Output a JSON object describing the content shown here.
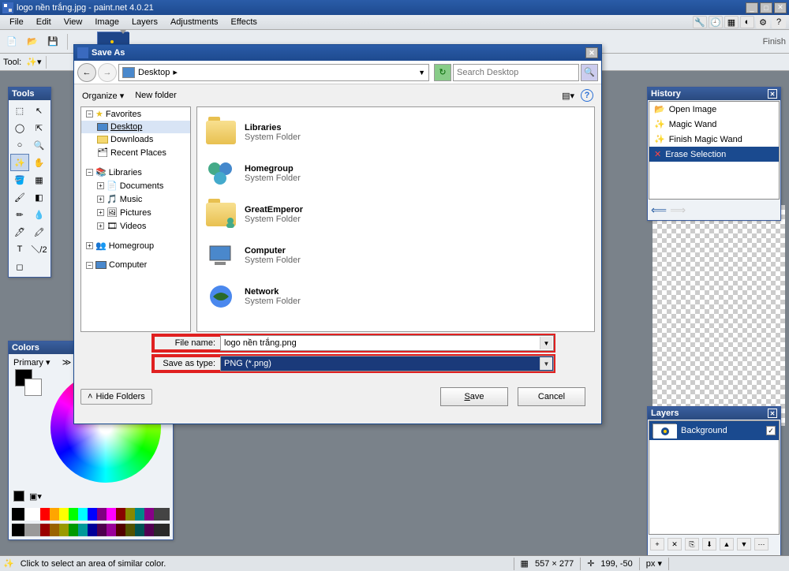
{
  "app": {
    "title": "logo nền trắng.jpg - paint.net 4.0.21",
    "menu": {
      "file": "File",
      "edit": "Edit",
      "view": "View",
      "image": "Image",
      "layers": "Layers",
      "adjustments": "Adjustments",
      "effects": "Effects"
    }
  },
  "toolrow": {
    "label": "Tool:"
  },
  "tools_panel": {
    "title": "Tools"
  },
  "colors_panel": {
    "title": "Colors",
    "primary": "Primary"
  },
  "history_panel": {
    "title": "History",
    "items": [
      "Open Image",
      "Magic Wand",
      "Finish Magic Wand",
      "Erase Selection"
    ]
  },
  "layers_panel": {
    "title": "Layers",
    "layer0": "Background"
  },
  "dialog": {
    "title": "Save As",
    "crumb": "Desktop",
    "search_placeholder": "Search Desktop",
    "organize": "Organize",
    "newfolder": "New folder",
    "tree": {
      "favorites": "Favorites",
      "desktop": "Desktop",
      "downloads": "Downloads",
      "recent": "Recent Places",
      "libraries": "Libraries",
      "documents": "Documents",
      "music": "Music",
      "pictures": "Pictures",
      "videos": "Videos",
      "homegroup": "Homegroup",
      "computer": "Computer"
    },
    "files": [
      {
        "name": "Libraries",
        "type": "System Folder",
        "icon": "folder"
      },
      {
        "name": "Homegroup",
        "type": "System Folder",
        "icon": "homegroup"
      },
      {
        "name": "GreatEmperor",
        "type": "System Folder",
        "icon": "user"
      },
      {
        "name": "Computer",
        "type": "System Folder",
        "icon": "computer"
      },
      {
        "name": "Network",
        "type": "System Folder",
        "icon": "network"
      }
    ],
    "filename_label": "File name:",
    "filename_value": "logo nền trắng.png",
    "type_label": "Save as type:",
    "type_value": "PNG (*.png)",
    "hide": "Hide Folders",
    "save": "Save",
    "cancel": "Cancel",
    "finish": "Finish"
  },
  "status": {
    "hint": "Click to select an area of similar color.",
    "dims": "557 × 277",
    "pos": "199, -50",
    "unit": "px"
  }
}
